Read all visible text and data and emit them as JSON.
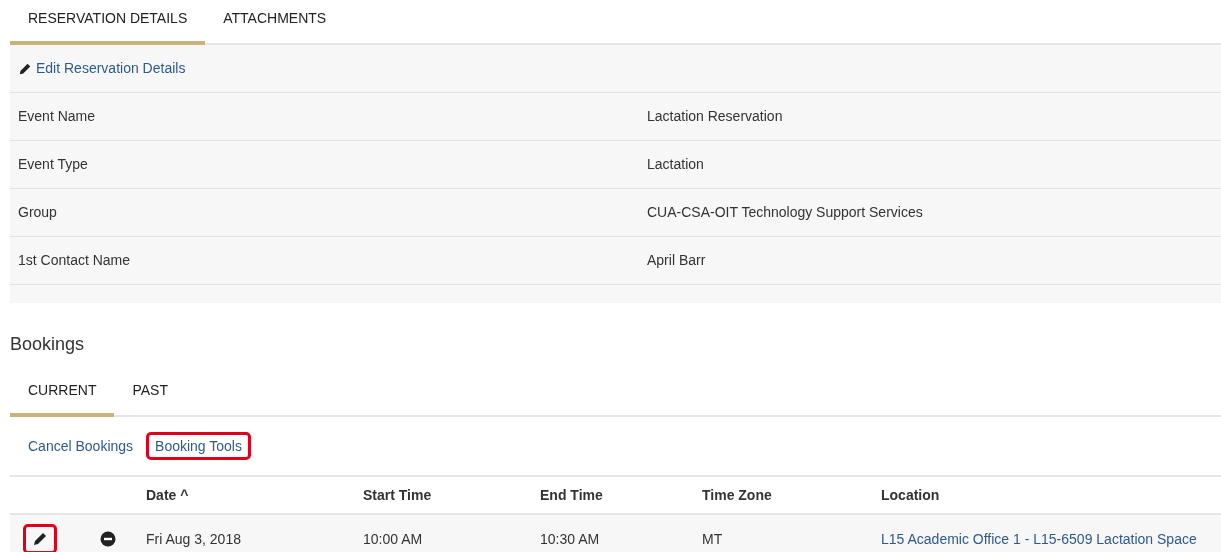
{
  "tabs": [
    {
      "label": "RESERVATION DETAILS",
      "selected": true
    },
    {
      "label": "ATTACHMENTS",
      "selected": false
    }
  ],
  "edit_link": "Edit Reservation Details",
  "details": [
    {
      "label": "Event Name",
      "value": "Lactation Reservation"
    },
    {
      "label": "Event Type",
      "value": "Lactation"
    },
    {
      "label": "Group",
      "value": "CUA-CSA-OIT Technology Support Services"
    },
    {
      "label": "1st Contact Name",
      "value": "April Barr"
    }
  ],
  "bookings": {
    "title": "Bookings",
    "tabs": [
      {
        "label": "CURRENT",
        "selected": true
      },
      {
        "label": "PAST",
        "selected": false
      }
    ],
    "actions": [
      {
        "label": "Cancel Bookings",
        "highlighted": false
      },
      {
        "label": "Booking Tools",
        "highlighted": true
      }
    ],
    "table": {
      "columns": [
        "Date ^",
        "Start Time",
        "End Time",
        "Time Zone",
        "Location"
      ],
      "rows": [
        {
          "edit_highlighted": true,
          "date": "Fri Aug 3, 2018",
          "start": "10:00 AM",
          "end": "10:30 AM",
          "zone": "MT",
          "location": "L15 Academic Office 1 - L15-6509 Lactation Space"
        }
      ]
    }
  }
}
